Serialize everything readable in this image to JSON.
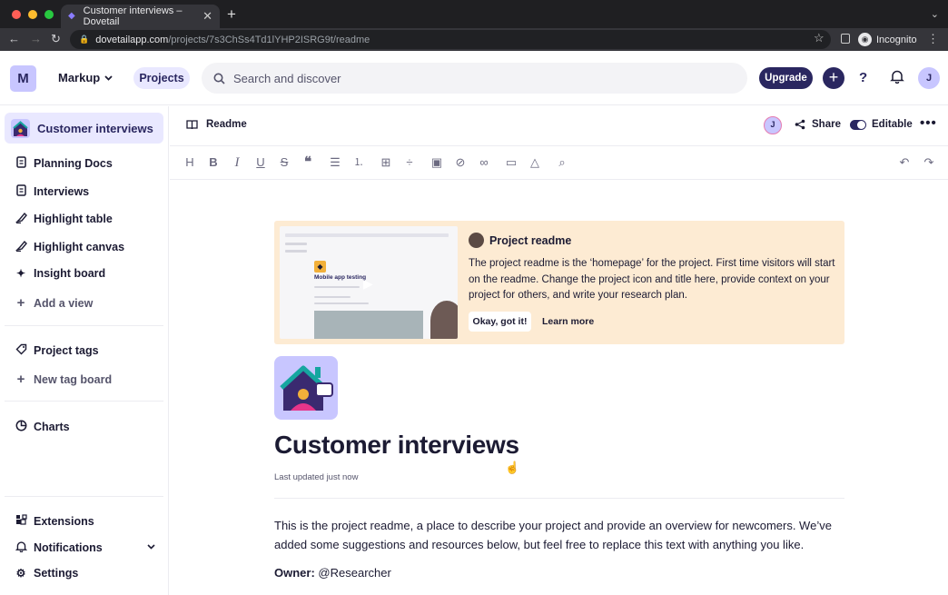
{
  "browser": {
    "tab_title": "Customer interviews – Dovetail",
    "url_host": "dovetailapp.com",
    "url_path": "/projects/7s3ChSs4Td1lYHP2ISRG9t/readme",
    "profile_label": "Incognito"
  },
  "topbar": {
    "workspace_initial": "M",
    "workspace_name": "Markup",
    "projects_label": "Projects",
    "search_placeholder": "Search and discover",
    "upgrade_label": "Upgrade",
    "help_label": "?",
    "user_initial": "J"
  },
  "sidebar": {
    "active_project": "Customer interviews",
    "items": [
      {
        "label": "Planning Docs",
        "icon": "doc-icon"
      },
      {
        "label": "Interviews",
        "icon": "doc-icon"
      },
      {
        "label": "Highlight table",
        "icon": "highlight-icon"
      },
      {
        "label": "Highlight canvas",
        "icon": "highlight-icon"
      },
      {
        "label": "Insight board",
        "icon": "sparkle-icon"
      },
      {
        "label": "Add a view",
        "icon": "plus-icon"
      }
    ],
    "tags": [
      {
        "label": "Project tags",
        "icon": "tag-icon"
      },
      {
        "label": "New tag board",
        "icon": "plus-icon"
      }
    ],
    "charts_label": "Charts",
    "bottom": [
      {
        "label": "Extensions",
        "icon": "extensions-icon"
      },
      {
        "label": "Notifications",
        "icon": "bell-icon"
      },
      {
        "label": "Settings",
        "icon": "gear-icon"
      }
    ]
  },
  "docbar": {
    "title": "Readme",
    "avatar_initial": "J",
    "share_label": "Share",
    "editable_label": "Editable"
  },
  "banner": {
    "title": "Project readme",
    "body": "The project readme is the ‘homepage’ for the project. First time visitors will start on the readme. Change the project icon and title here, provide context on your project for others, and write your research plan.",
    "okay_label": "Okay, got it!",
    "learn_label": "Learn more",
    "thumb_title": "Mobile app testing"
  },
  "doc": {
    "title": "Customer interviews",
    "updated": "Last updated just now",
    "paragraph": "This is the project readme, a place to describe your project and provide an overview for newcomers. We’ve added some suggestions and resources below, but feel free to replace this text with anything you like.",
    "owner_label": "Owner:",
    "owner_value": "@Researcher"
  },
  "colors": {
    "brand": "#2a2760",
    "accent_light": "#e9e8ff",
    "banner_bg": "#fdebd3"
  }
}
